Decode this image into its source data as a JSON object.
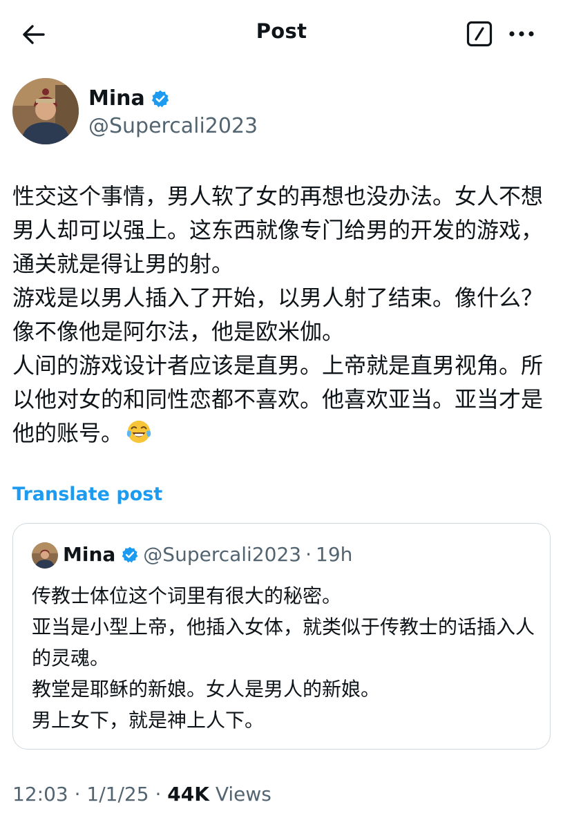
{
  "header": {
    "title": "Post",
    "back_icon": "arrow-left-icon",
    "edit_icon": "edit-square-icon",
    "more_icon": "more-horizontal-icon"
  },
  "author": {
    "name": "Mina",
    "handle": "@Supercali2023",
    "verified": true
  },
  "post": {
    "text": "性交这个事情，男人软了女的再想也没办法。女人不想男人却可以强上。这东西就像专门给男的开发的游戏，通关就是得让男的射。\n游戏是以男人插入了开始，以男人射了结束。像什么？像不像他是阿尔法，他是欧米伽。\n人间的游戏设计者应该是直男。上帝就是直男视角。所以他对女的和同性恋都不喜欢。他喜欢亚当。亚当才是他的账号。",
    "emoji": "tears-of-joy-emoji",
    "translate_label": "Translate post"
  },
  "quote": {
    "name": "Mina",
    "handle": "@Supercali2023",
    "separator": "·",
    "time": "19h",
    "text": "传教士体位这个词里有很大的秘密。\n亚当是小型上帝，他插入女体，就类似于传教士的话插入人的灵魂。\n教堂是耶稣的新娘。女人是男人的新娘。\n男上女下，就是神上人下。"
  },
  "meta": {
    "time": "12:03",
    "date": "1/1/25",
    "views_count": "44K",
    "views_label": "Views",
    "separator": "·"
  },
  "colors": {
    "accent": "#1d9bf0",
    "text": "#0f1419",
    "secondary": "#536471",
    "border": "#cfd9de"
  }
}
